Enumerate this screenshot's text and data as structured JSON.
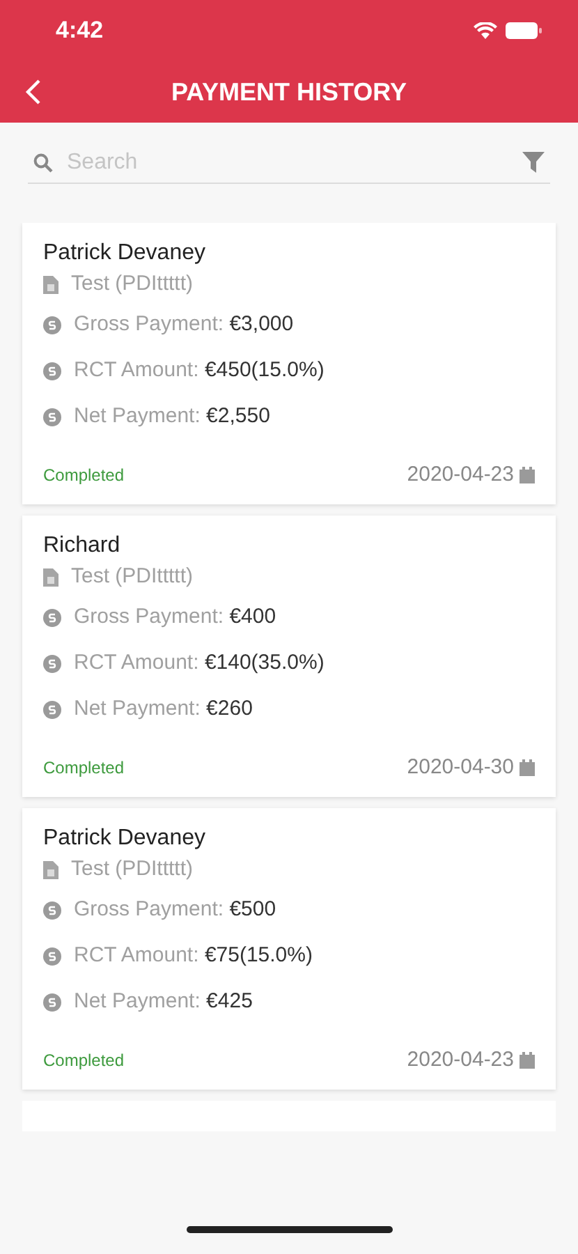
{
  "status_bar": {
    "time": "4:42"
  },
  "header": {
    "title": "PAYMENT HISTORY"
  },
  "search": {
    "placeholder": "Search"
  },
  "payments": [
    {
      "name": "Patrick Devaney",
      "project": "Test (PDIttttt)",
      "details": [
        {
          "label": "Gross Payment:",
          "value": "€3,000"
        },
        {
          "label": "RCT Amount:",
          "value": "€450(15.0%)"
        },
        {
          "label": "Net Payment:",
          "value": "€2,550"
        }
      ],
      "status": "Completed",
      "date": "2020-04-23"
    },
    {
      "name": "Richard",
      "project": "Test (PDIttttt)",
      "details": [
        {
          "label": "Gross Payment:",
          "value": "€400"
        },
        {
          "label": "RCT Amount:",
          "value": "€140(35.0%)"
        },
        {
          "label": "Net Payment:",
          "value": "€260"
        }
      ],
      "status": "Completed",
      "date": "2020-04-30"
    },
    {
      "name": "Patrick Devaney",
      "project": "Test (PDIttttt)",
      "details": [
        {
          "label": "Gross Payment:",
          "value": "€500"
        },
        {
          "label": "RCT Amount:",
          "value": "€75(15.0%)"
        },
        {
          "label": "Net Payment:",
          "value": "€425"
        }
      ],
      "status": "Completed",
      "date": "2020-04-23"
    }
  ]
}
